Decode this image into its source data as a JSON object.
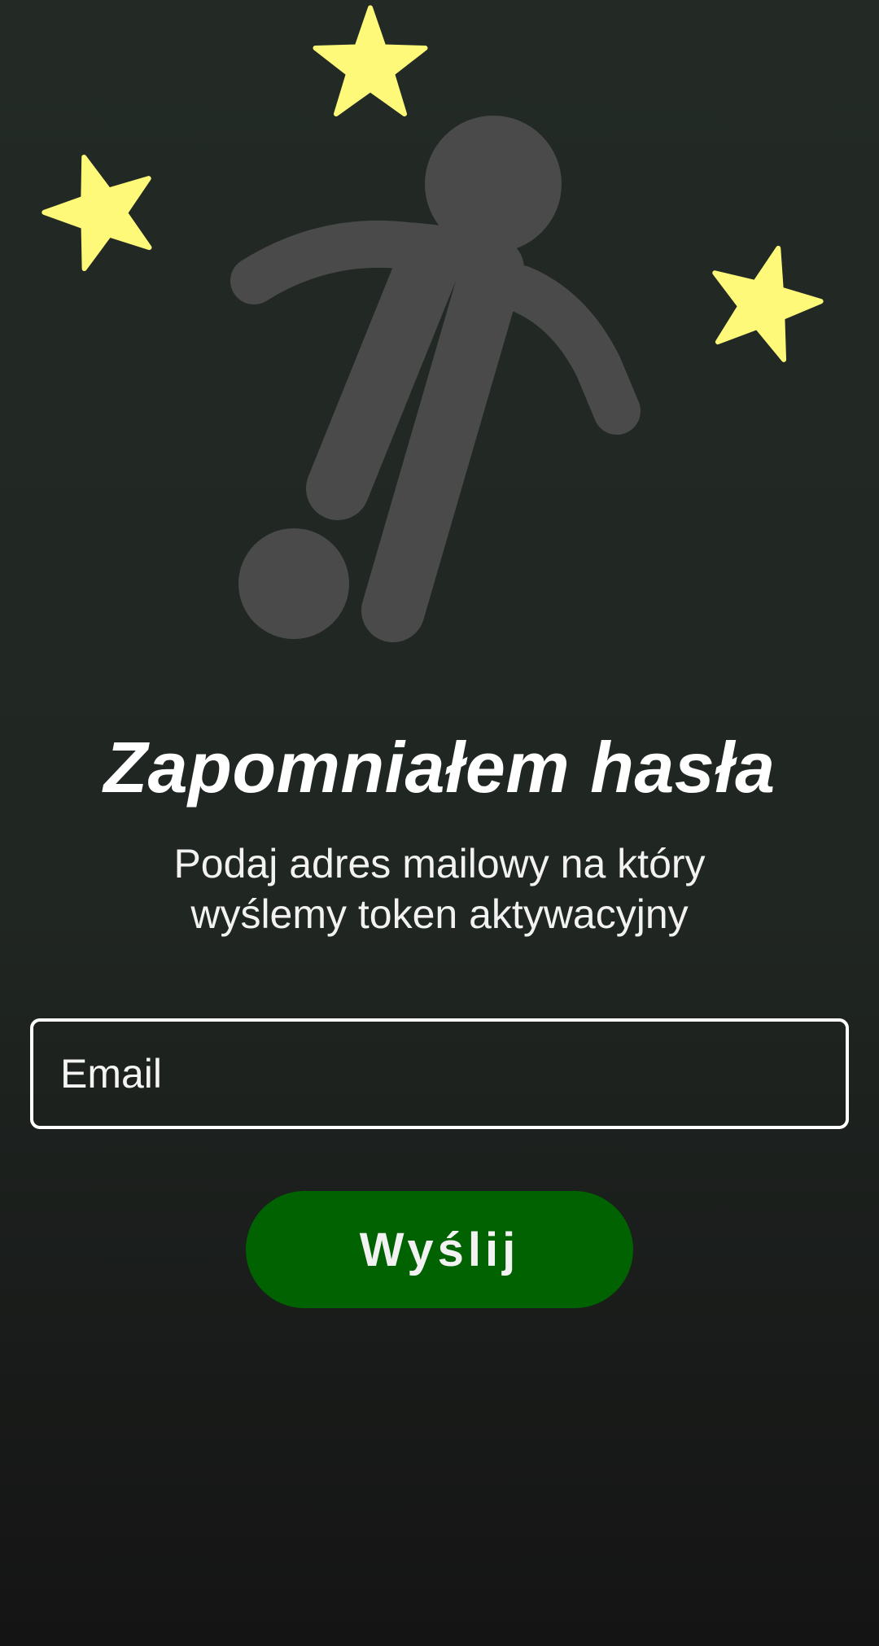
{
  "hero": {
    "illustration": "soccer-player-icon",
    "decoration": "star-icon",
    "colors": {
      "star": "#fff97a",
      "player": "#4a4a4a"
    }
  },
  "header": {
    "title": "Zapomniałem hasła",
    "subtitle_line1": "Podaj adres mailowy na który",
    "subtitle_line2": "wyślemy token aktywacyjny"
  },
  "form": {
    "email_placeholder": "Email",
    "email_value": ""
  },
  "actions": {
    "send_label": "Wyślij"
  },
  "colors": {
    "background_top": "#232a26",
    "background_bottom": "#141414",
    "button": "#006200",
    "text": "#ffffff",
    "input_border": "#ffffff"
  }
}
